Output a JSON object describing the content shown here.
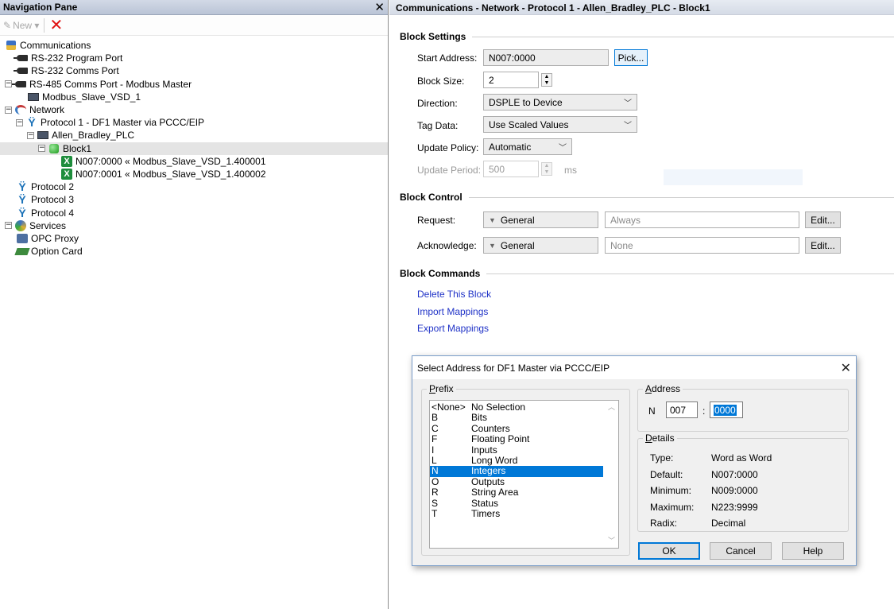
{
  "nav": {
    "title": "Navigation Pane",
    "toolbar": {
      "new_label": "New ▾"
    },
    "tree": [
      {
        "label": "Communications",
        "icon": "communications-icon",
        "indent": 0,
        "expander": "none"
      },
      {
        "label": "RS-232 Program Port",
        "icon": "port-icon",
        "indent": 1,
        "expander": "none"
      },
      {
        "label": "RS-232 Comms Port",
        "icon": "port-icon",
        "indent": 1,
        "expander": "none"
      },
      {
        "label": "RS-485 Comms Port - Modbus Master",
        "icon": "port-icon",
        "indent": 0,
        "expander": "minus"
      },
      {
        "label": "Modbus_Slave_VSD_1",
        "icon": "device-icon",
        "indent": 2,
        "expander": "none"
      },
      {
        "label": "Network",
        "icon": "network-icon",
        "indent": 0,
        "expander": "minus"
      },
      {
        "label": "Protocol 1 - DF1 Master via PCCC/EIP",
        "icon": "protocol-icon",
        "indent": 1,
        "expander": "minus"
      },
      {
        "label": "Allen_Bradley_PLC",
        "icon": "device-icon",
        "indent": 2,
        "expander": "minus"
      },
      {
        "label": "Block1",
        "icon": "block-icon",
        "indent": 3,
        "expander": "minus",
        "selected": true
      },
      {
        "label": "N007:0000 « Modbus_Slave_VSD_1.400001",
        "icon": "mapping-icon",
        "indent": 5,
        "expander": "none"
      },
      {
        "label": "N007:0001 « Modbus_Slave_VSD_1.400002",
        "icon": "mapping-icon",
        "indent": 5,
        "expander": "none"
      },
      {
        "label": "Protocol 2",
        "icon": "protocol-icon",
        "indent": 1,
        "expander": "none"
      },
      {
        "label": "Protocol 3",
        "icon": "protocol-icon",
        "indent": 1,
        "expander": "none"
      },
      {
        "label": "Protocol 4",
        "icon": "protocol-icon",
        "indent": 1,
        "expander": "none"
      },
      {
        "label": "Services",
        "icon": "services-icon",
        "indent": 0,
        "expander": "minus"
      },
      {
        "label": "OPC Proxy",
        "icon": "opc-proxy-icon",
        "indent": 1,
        "expander": "none"
      },
      {
        "label": "Option Card",
        "icon": "option-card-icon",
        "indent": 1,
        "expander": "none"
      }
    ]
  },
  "main": {
    "title": "Communications - Network - Protocol 1 - Allen_Bradley_PLC - Block1",
    "block_settings": {
      "heading": "Block Settings",
      "start_address_label": "Start Address:",
      "start_address_value": "N007:0000",
      "pick_label": "Pick...",
      "block_size_label": "Block Size:",
      "block_size_value": "2",
      "direction_label": "Direction:",
      "direction_value": "DSPLE to Device",
      "tag_data_label": "Tag Data:",
      "tag_data_value": "Use Scaled Values",
      "update_policy_label": "Update Policy:",
      "update_policy_value": "Automatic",
      "update_period_label": "Update Period:",
      "update_period_value": "500",
      "update_period_unit": "ms"
    },
    "block_control": {
      "heading": "Block Control",
      "request_label": "Request:",
      "request_category": "General",
      "request_value": "Always",
      "acknowledge_label": "Acknowledge:",
      "acknowledge_category": "General",
      "acknowledge_value": "None",
      "edit_label": "Edit..."
    },
    "block_commands": {
      "heading": "Block Commands",
      "delete": "Delete This Block",
      "import": "Import Mappings",
      "export": "Export Mappings"
    }
  },
  "dialog": {
    "title": "Select Address for DF1 Master via PCCC/EIP",
    "prefix_group": {
      "underline": "P",
      "rest": "refix"
    },
    "prefixes": [
      {
        "key": "<None>",
        "desc": "No Selection"
      },
      {
        "key": "B",
        "desc": "Bits"
      },
      {
        "key": "C",
        "desc": "Counters"
      },
      {
        "key": "F",
        "desc": "Floating Point"
      },
      {
        "key": "I",
        "desc": "Inputs"
      },
      {
        "key": "L",
        "desc": "Long Word"
      },
      {
        "key": "N",
        "desc": "Integers",
        "selected": true
      },
      {
        "key": "O",
        "desc": "Outputs"
      },
      {
        "key": "R",
        "desc": "String Area"
      },
      {
        "key": "S",
        "desc": "Status"
      },
      {
        "key": "T",
        "desc": "Timers"
      }
    ],
    "address_group": {
      "underline": "A",
      "rest": "ddress"
    },
    "address": {
      "prefix": "N",
      "file": "007",
      "separator": ":",
      "element": "0000"
    },
    "details_group": {
      "underline": "D",
      "rest": "etails"
    },
    "details": [
      {
        "label": "Type:",
        "value": "Word as Word"
      },
      {
        "label": "Default:",
        "value": "N007:0000"
      },
      {
        "label": "Minimum:",
        "value": "N009:0000"
      },
      {
        "label": "Maximum:",
        "value": "N223:9999"
      },
      {
        "label": "Radix:",
        "value": "Decimal"
      }
    ],
    "buttons": {
      "ok": "OK",
      "cancel": "Cancel",
      "help": "Help"
    }
  }
}
